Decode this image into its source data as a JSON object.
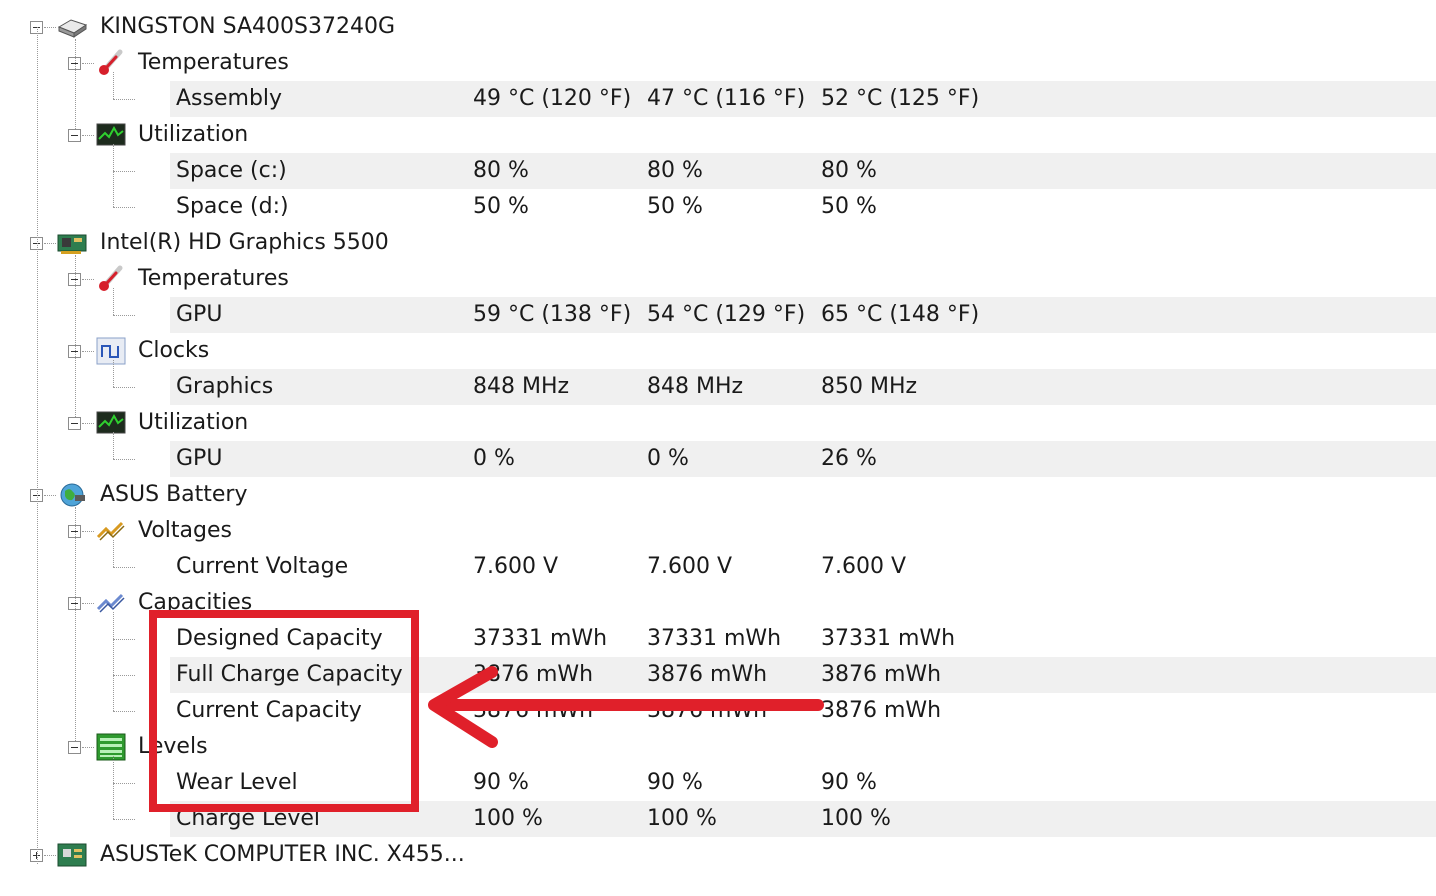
{
  "tree": [
    {
      "kind": "device",
      "label": "KINGSTON SA400S37240G",
      "icon": "hdd-icon",
      "name": "device-kingston"
    },
    {
      "kind": "group",
      "label": "Temperatures",
      "icon": "thermometer-icon",
      "name": "group-temperatures"
    },
    {
      "kind": "sensor",
      "label": "Assembly",
      "values": [
        "49 °C  (120 °F)",
        "47 °C  (116 °F)",
        "52 °C  (125 °F)"
      ],
      "name": "sensor-assembly",
      "last": true
    },
    {
      "kind": "group",
      "label": "Utilization",
      "icon": "utilization-monitor-icon",
      "name": "group-utilization"
    },
    {
      "kind": "sensor",
      "label": "Space (c:)",
      "values": [
        "80 %",
        "80 %",
        "80 %"
      ],
      "name": "sensor-space-c"
    },
    {
      "kind": "sensor",
      "label": "Space (d:)",
      "values": [
        "50 %",
        "50 %",
        "50 %"
      ],
      "name": "sensor-space-d",
      "last": true
    },
    {
      "kind": "device",
      "label": "Intel(R) HD Graphics 5500",
      "icon": "graphics-card-icon",
      "name": "device-intel-graphics"
    },
    {
      "kind": "group",
      "label": "Temperatures",
      "icon": "thermometer-icon",
      "name": "group-temperatures"
    },
    {
      "kind": "sensor",
      "label": "GPU",
      "values": [
        "59 °C  (138 °F)",
        "54 °C  (129 °F)",
        "65 °C  (148 °F)"
      ],
      "name": "sensor-gpu-temp",
      "last": true
    },
    {
      "kind": "group",
      "label": "Clocks",
      "icon": "clock-wave-icon",
      "name": "group-clocks"
    },
    {
      "kind": "sensor",
      "label": "Graphics",
      "values": [
        "848 MHz",
        "848 MHz",
        "850 MHz"
      ],
      "name": "sensor-graphics-clock",
      "last": true
    },
    {
      "kind": "group",
      "label": "Utilization",
      "icon": "utilization-monitor-icon",
      "name": "group-utilization"
    },
    {
      "kind": "sensor",
      "label": "GPU",
      "values": [
        "0 %",
        "0 %",
        "26 %"
      ],
      "name": "sensor-gpu-utilization",
      "last": true
    },
    {
      "kind": "device",
      "label": "ASUS Battery",
      "icon": "battery-globe-icon",
      "name": "device-asus-battery"
    },
    {
      "kind": "group",
      "label": "Voltages",
      "icon": "voltage-icon",
      "name": "group-voltages"
    },
    {
      "kind": "sensor",
      "label": "Current Voltage",
      "values": [
        "7.600 V",
        "7.600 V",
        "7.600 V"
      ],
      "name": "sensor-current-voltage",
      "last": true
    },
    {
      "kind": "group",
      "label": "Capacities",
      "icon": "capacity-graph-icon",
      "name": "group-capacities"
    },
    {
      "kind": "sensor",
      "label": "Designed Capacity",
      "values": [
        "37331 mWh",
        "37331 mWh",
        "37331 mWh"
      ],
      "name": "sensor-designed-capacity"
    },
    {
      "kind": "sensor",
      "label": "Full Charge Capacity",
      "values": [
        "3876 mWh",
        "3876 mWh",
        "3876 mWh"
      ],
      "name": "sensor-full-charge-capacity"
    },
    {
      "kind": "sensor",
      "label": "Current Capacity",
      "values": [
        "3876 mWh",
        "3876 mWh",
        "3876 mWh"
      ],
      "name": "sensor-current-capacity",
      "last": true
    },
    {
      "kind": "group",
      "label": "Levels",
      "icon": "levels-icon",
      "name": "group-levels"
    },
    {
      "kind": "sensor",
      "label": "Wear Level",
      "values": [
        "90 %",
        "90 %",
        "90 %"
      ],
      "name": "sensor-wear-level"
    },
    {
      "kind": "sensor",
      "label": "Charge Level",
      "values": [
        "100 %",
        "100 %",
        "100 %"
      ],
      "name": "sensor-charge-level",
      "last": true
    },
    {
      "kind": "device",
      "label": "ASUSTeK COMPUTER INC. X455...",
      "icon": "motherboard-icon",
      "name": "device-asustek-motherboard",
      "collapsed": true
    }
  ],
  "colors": {
    "annotation_red": "#e0202a",
    "row_band": "#f0f0f0",
    "tree_lines": "#9a9a9a"
  }
}
